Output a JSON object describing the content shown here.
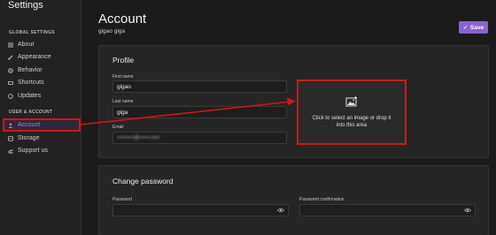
{
  "sidebar": {
    "title": "Settings",
    "global_heading": "GLOBAL SETTINGS",
    "global_items": [
      {
        "label": "About",
        "icon": "list-icon"
      },
      {
        "label": "Appearance",
        "icon": "brush-icon"
      },
      {
        "label": "Behavior",
        "icon": "gear-icon"
      },
      {
        "label": "Shortcuts",
        "icon": "keyboard-icon"
      },
      {
        "label": "Updates",
        "icon": "refresh-icon"
      }
    ],
    "account_heading": "USER & ACCOUNT",
    "account_items": [
      {
        "label": "Account",
        "icon": "user-icon",
        "active": true
      },
      {
        "label": "Storage",
        "icon": "database-icon"
      },
      {
        "label": "Support us",
        "icon": "hands-icon"
      }
    ]
  },
  "header": {
    "title": "Account",
    "subtitle": "gigao giga",
    "save_label": "Save"
  },
  "profile": {
    "title": "Profile",
    "first_name_label": "First name",
    "first_name_value": "gigao",
    "last_name_label": "Last name",
    "last_name_value": "giga",
    "email_label": "Email",
    "email_value": "••••••••••@••••••.com",
    "dropzone_text": "Click to select an image or drop it into this area"
  },
  "password": {
    "title": "Change password",
    "password_label": "Password",
    "confirm_label": "Password confirmation"
  },
  "colors": {
    "accent": "#8a63d2",
    "annotation_red": "#d11616",
    "background": "#1b1b1b",
    "card": "#262626"
  }
}
